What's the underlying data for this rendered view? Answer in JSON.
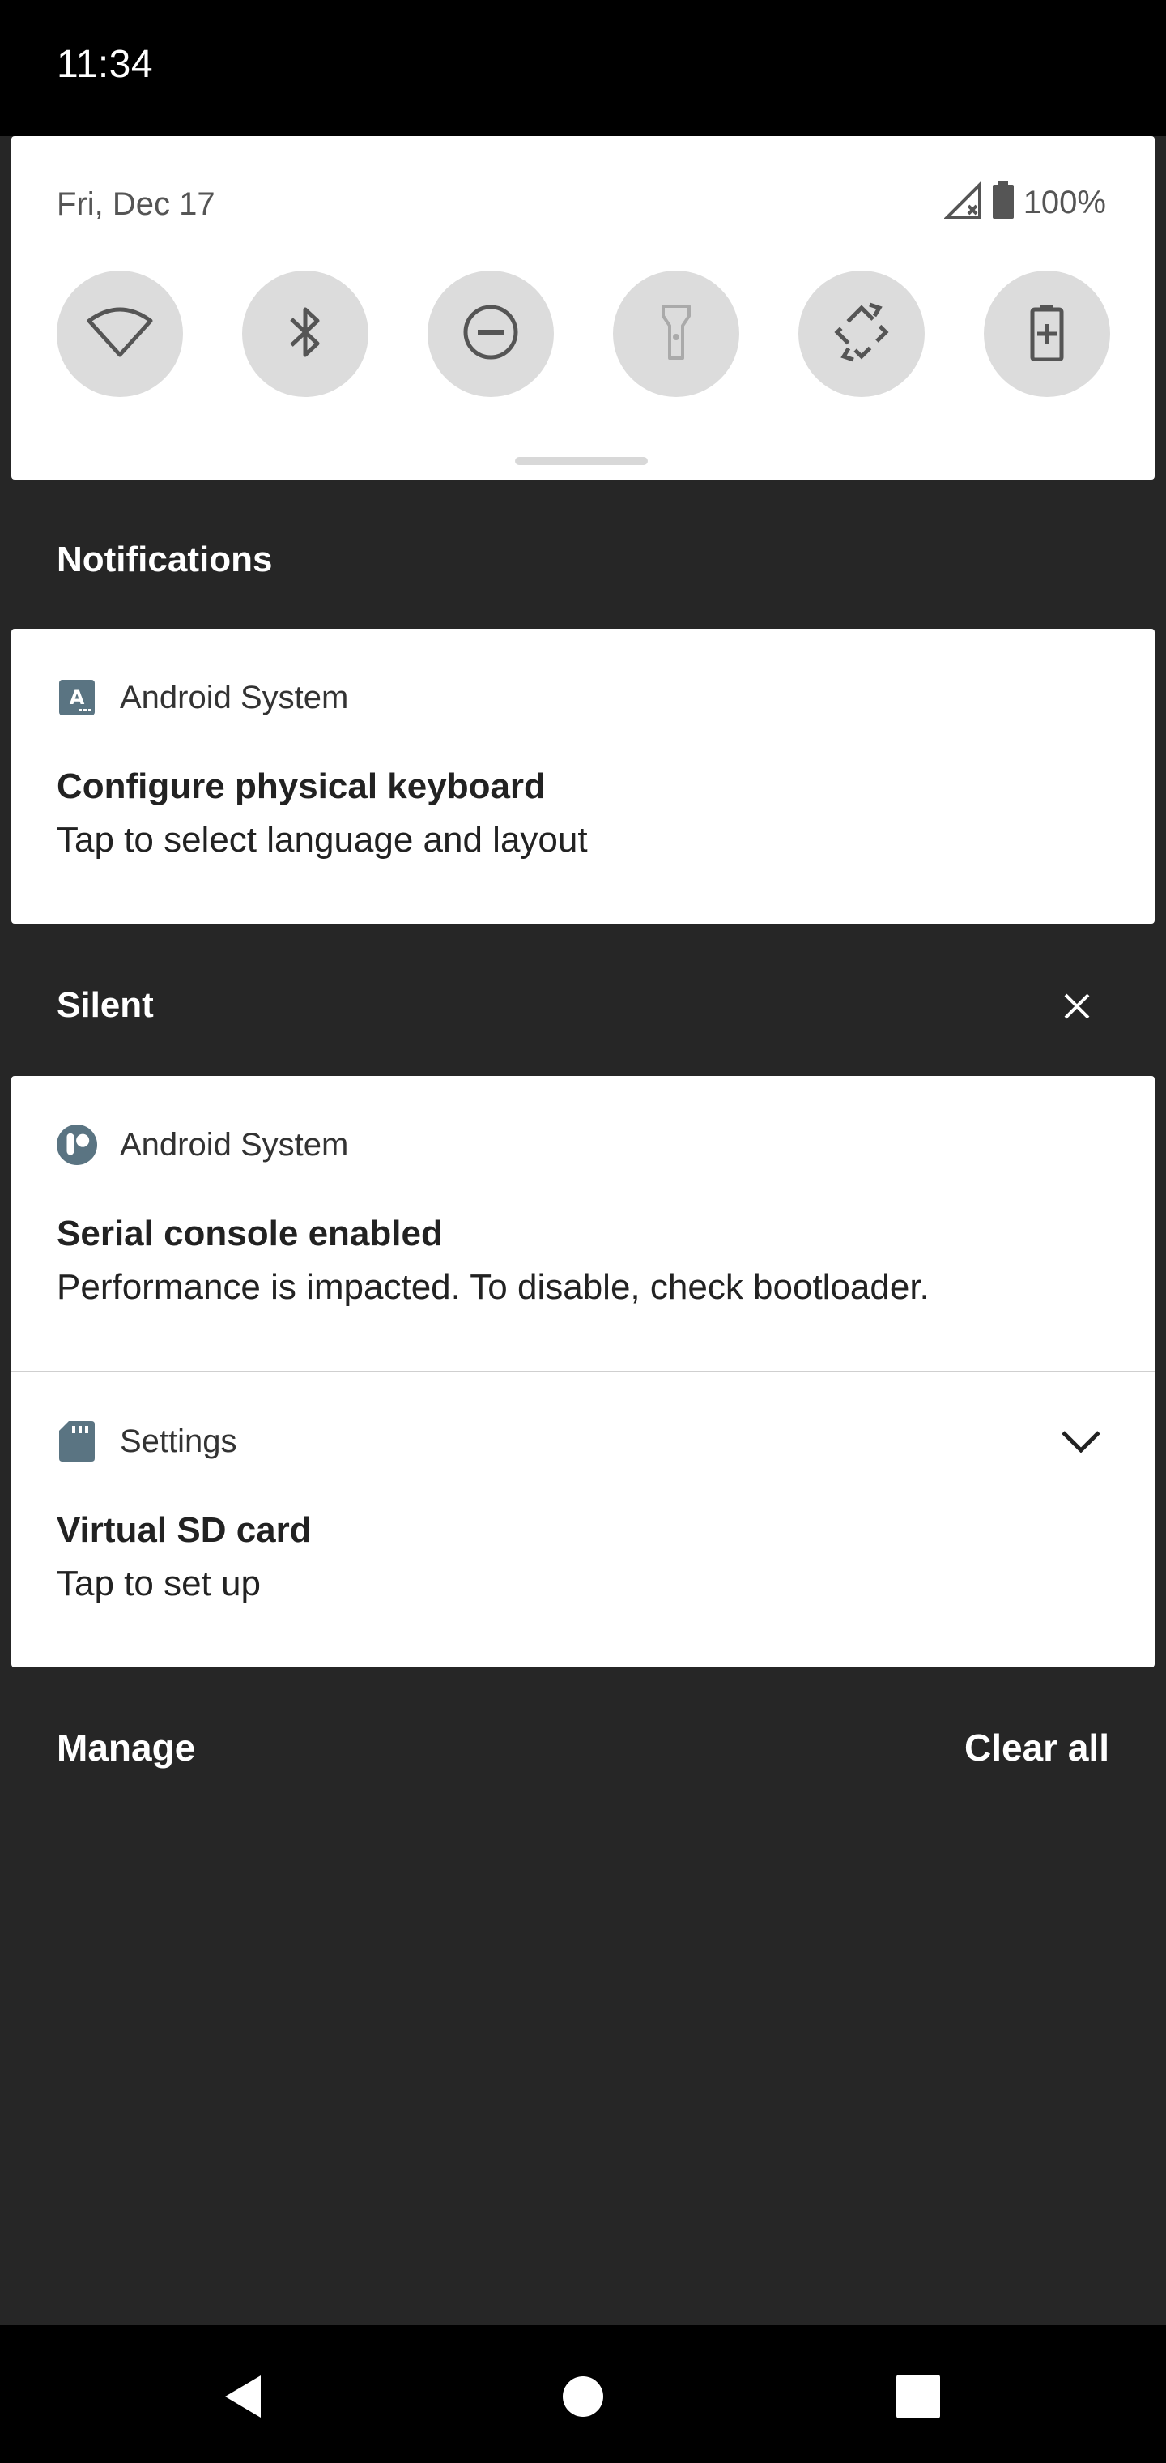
{
  "status_bar": {
    "time": "11:34"
  },
  "quick_settings": {
    "date": "Fri, Dec 17",
    "battery_percent": "100%",
    "tiles": [
      {
        "name": "wifi",
        "icon": "wifi-icon"
      },
      {
        "name": "bluetooth",
        "icon": "bluetooth-icon"
      },
      {
        "name": "do-not-disturb",
        "icon": "do-not-disturb-icon"
      },
      {
        "name": "flashlight",
        "icon": "flashlight-icon"
      },
      {
        "name": "auto-rotate",
        "icon": "auto-rotate-icon"
      },
      {
        "name": "battery-saver",
        "icon": "battery-saver-icon"
      }
    ]
  },
  "notifications": {
    "header": "Notifications",
    "items": [
      {
        "app": "Android System",
        "icon": "keyboard-a-icon",
        "title": "Configure physical keyboard",
        "text": "Tap to select language and layout"
      }
    ]
  },
  "silent": {
    "header": "Silent",
    "items": [
      {
        "app": "Android System",
        "icon": "console-icon",
        "title": "Serial console enabled",
        "text": "Performance is impacted. To disable, check bootloader."
      },
      {
        "app": "Settings",
        "icon": "sd-card-icon",
        "title": "Virtual SD card",
        "text": "Tap to set up"
      }
    ]
  },
  "footer": {
    "manage": "Manage",
    "clear_all": "Clear all"
  },
  "colors": {
    "app_icon": "#5a7482",
    "tile_bg": "#dcdcdc",
    "shade_bg": "#262626"
  }
}
